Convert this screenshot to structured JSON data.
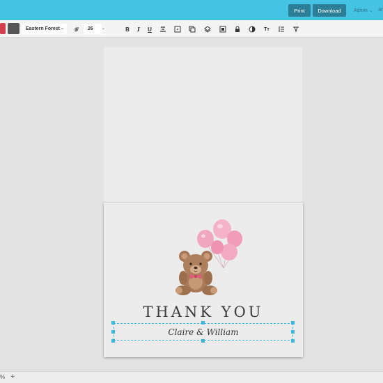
{
  "topbar": {
    "print_label": "Print",
    "download_label": "Download",
    "admin_label": "Admin",
    "admin_chevron": "⌄",
    "cut_link_label": "St",
    "bg_color": "#45c3e3",
    "button_color": "#2d7f98"
  },
  "toolbar": {
    "font_name": "Eastern Forest",
    "font_size": "26",
    "swatch_colors": [
      "#d23f4d",
      "#555555"
    ],
    "tools": [
      "font-style-icon",
      "bold-icon",
      "italic-icon",
      "underline-icon",
      "align-icon",
      "image-resize-icon",
      "duplicate-icon",
      "layers-icon",
      "bring-forward-icon",
      "lock-icon",
      "opacity-icon",
      "text-case-icon",
      "line-spacing-icon",
      "letter-spacing-icon"
    ],
    "tool_glyphs": {
      "bold": "B",
      "italic": "I",
      "underline": "U",
      "text_case": "Tт"
    }
  },
  "card": {
    "title": "THANK YOU",
    "names": "Claire & William"
  },
  "statusbar": {
    "zoom_fragment": "%",
    "zoom_in": "+"
  }
}
